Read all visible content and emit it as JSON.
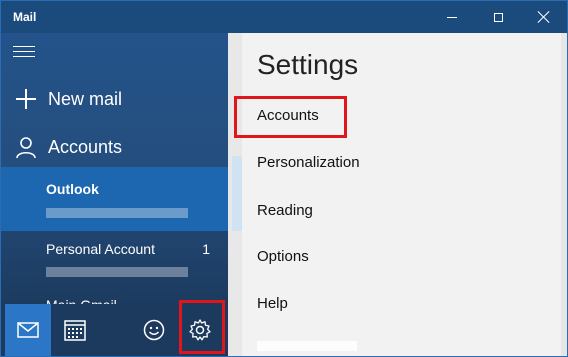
{
  "window": {
    "title": "Mail"
  },
  "sidebar": {
    "new_mail_label": "New mail",
    "accounts_label": "Accounts",
    "accounts": [
      {
        "name": "Outlook",
        "selected": true,
        "unread": ""
      },
      {
        "name": "Personal Account",
        "selected": false,
        "unread": "1"
      },
      {
        "name": "Main Gmail",
        "selected": false,
        "unread": ""
      }
    ]
  },
  "bottombar": {
    "items": [
      "mail-icon",
      "calendar-icon",
      "feedback-icon",
      "settings-gear-icon"
    ]
  },
  "settings": {
    "title": "Settings",
    "items": [
      "Accounts",
      "Personalization",
      "Reading",
      "Options",
      "Help"
    ]
  },
  "colors": {
    "titlebar": "#1b4a7d",
    "sidebar": "#23538a",
    "selected_account": "#1d66b0",
    "highlight": "#e0161c"
  }
}
